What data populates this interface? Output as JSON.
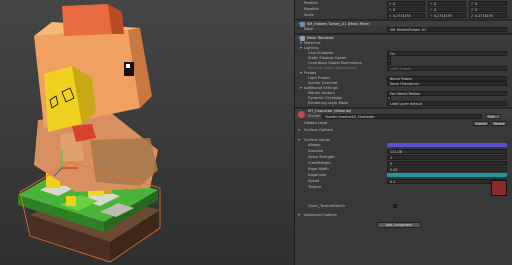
{
  "inspector": {
    "transform": {
      "rotation_label": "Rotation",
      "scale_label": "Scale",
      "rows": [
        {
          "label": "Position",
          "x": "0",
          "y": "0",
          "z": "0"
        },
        {
          "label": "Rotation",
          "x": "0",
          "y": "0",
          "z": "0"
        },
        {
          "label": "Scale",
          "x": "0.2714155",
          "y": "0.2714155",
          "z": "0.2714155"
        }
      ]
    },
    "mesh_filter": {
      "title": "SM_Hidden Turbey_01 (Mesh Filter)",
      "mesh_label": "Mesh",
      "mesh_value": "SM_HiddenTurbey_01"
    },
    "mesh_renderer": {
      "title": "Mesh Renderer",
      "materials_label": "Materials",
      "lighting_label": "Lighting",
      "cast_shadows_label": "Cast Shadows",
      "cast_shadows_value": "On",
      "static_shadow_caster_label": "Static Shadow Caster",
      "contribute_gi_label": "Contribute Global Illumination",
      "receive_gi_label": "Receive Global Illumination",
      "receive_gi_value": "Light Probes",
      "probes_label": "Probes",
      "light_probes_label": "Light Probes",
      "light_probes_value": "Blend Probes",
      "anchor_override_label": "Anchor Override",
      "anchor_override_value": "None (Transform)",
      "additional_settings_label": "Additional Settings",
      "motion_vectors_label": "Motion Vectors",
      "motion_vectors_value": "Per Object Motion",
      "dynamic_occlusion_label": "Dynamic Occlusion",
      "rendering_layer_mask_label": "Rendering Layer Mask",
      "rendering_layer_mask_value": "Light Layer default"
    },
    "material": {
      "title": "MT_Character (Material)",
      "shader_label": "Shader",
      "shader_value": "Shader Graphs/SG_Character",
      "edit_label": "Edit...",
      "submenu_label": "Hidden Local",
      "submenu_right": "Submit",
      "revert_label": "Revert",
      "surface_options_label": "Surface Options",
      "surface_inputs_label": "Surface Inputs",
      "albedo_label": "Albedo",
      "dissolve_label": "Dissolve",
      "dissolve_value": "121.08",
      "noise_strength_label": "Noise Strength",
      "noise_strength_value": "1",
      "cutoff_height_label": "CutoffHeight",
      "cutoff_height_value": "0",
      "edge_width_label": "Edge Width",
      "edge_width_value": "0.02",
      "edge_color_label": "EdgeColor",
      "speed_label": "Speed",
      "speed_value": "0.1",
      "texture_label": "Texture",
      "toggle_label": "Outer_TextureSwitch",
      "advanced_label": "Advanced Options",
      "add_component_label": "Add Component"
    }
  },
  "colors": {
    "albedo": "#5a4fd8",
    "edge_color": "#1a9aa0",
    "selection": "#f07020"
  }
}
